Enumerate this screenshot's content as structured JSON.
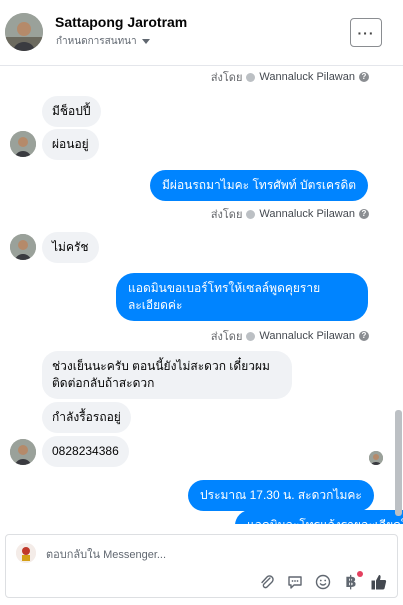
{
  "header": {
    "name": "Sattapong Jarotram",
    "subtitle": "กำหนดการสนทนา",
    "more_label": "···"
  },
  "messages": [
    {
      "type": "sent_by",
      "prefix": "ส่งโดย",
      "name": "Wannaluck Pilawan"
    },
    {
      "type": "in",
      "text": "มีช็อปปี้"
    },
    {
      "type": "in",
      "text": "ผ่อนอยู่"
    },
    {
      "type": "out",
      "text": "มีผ่อนรถมาไมคะ  โทรศัพท์ บัตรเครดิต"
    },
    {
      "type": "sent_by",
      "prefix": "ส่งโดย",
      "name": "Wannaluck Pilawan"
    },
    {
      "type": "in",
      "text": "ไม่ครัช"
    },
    {
      "type": "out",
      "text": "แอดมินขอเบอร์โทรให้เซลล์พูดคุยรายละเอียดค่ะ"
    },
    {
      "type": "sent_by",
      "prefix": "ส่งโดย",
      "name": "Wannaluck Pilawan"
    },
    {
      "type": "in",
      "text": "ช่วงเย็นนะครับ  ตอนนี้ยังไม่สะดวก เดี๋ยวผมติดต่อกลับถ้าสะดวก"
    },
    {
      "type": "in",
      "text": "กำลังรื้อรถอยู่"
    },
    {
      "type": "in",
      "text": "0828234386"
    },
    {
      "type": "out",
      "text": "ประมาณ 17.30 น.  สะดวกไมคะ"
    },
    {
      "type": "out",
      "text": "แอดมินจะโทรแจ้งรายละเอียดให้นะคะ"
    }
  ],
  "composer": {
    "placeholder": "ตอบกลับใน Messenger..."
  },
  "tools": {
    "attach": "paperclip-icon",
    "quick_reply": "speech-bubble-icon",
    "emoji": "smiley-icon",
    "payment": "฿",
    "like": "thumbs-up-icon"
  },
  "colors": {
    "outgoing": "#0084ff",
    "incoming": "#f0f2f5",
    "notification_dot": "#e4405f"
  }
}
